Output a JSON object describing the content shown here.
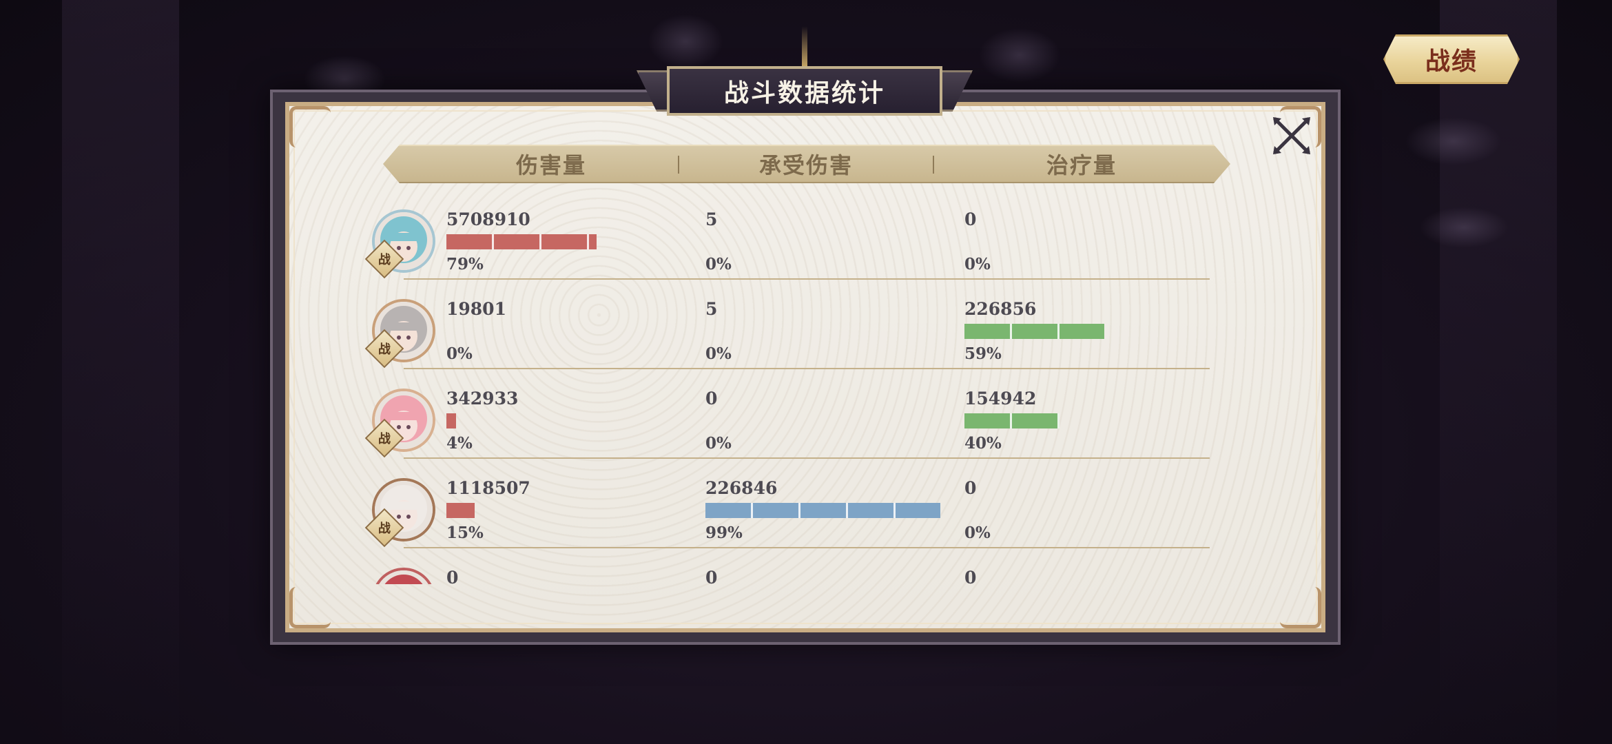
{
  "title": "战斗数据统计",
  "record_button": "战绩",
  "columns": [
    "伤害量",
    "承受伤害",
    "治疗量"
  ],
  "badge_label": "战",
  "colors": {
    "damage": "#c66762",
    "taken": "#7ea4c6",
    "heal": "#7ab66f"
  },
  "rows": [
    {
      "avatar": {
        "hair": "#7fc3cf",
        "skin": "#f4e2d8",
        "ring": "#a6c6d2"
      },
      "damage": {
        "value": "5708910",
        "pct": "79%",
        "frac": 0.79
      },
      "taken": {
        "value": "5",
        "pct": "0%",
        "frac": 0
      },
      "heal": {
        "value": "0",
        "pct": "0%",
        "frac": 0
      }
    },
    {
      "avatar": {
        "hair": "#b8b3b2",
        "skin": "#f4e2d8",
        "ring": "#c9a07a"
      },
      "damage": {
        "value": "19801",
        "pct": "0%",
        "frac": 0
      },
      "taken": {
        "value": "5",
        "pct": "0%",
        "frac": 0
      },
      "heal": {
        "value": "226856",
        "pct": "59%",
        "frac": 0.59
      }
    },
    {
      "avatar": {
        "hair": "#f0a4b0",
        "skin": "#f6e0dc",
        "ring": "#d8b090"
      },
      "damage": {
        "value": "342933",
        "pct": "4%",
        "frac": 0.04
      },
      "taken": {
        "value": "0",
        "pct": "0%",
        "frac": 0
      },
      "heal": {
        "value": "154942",
        "pct": "40%",
        "frac": 0.4
      }
    },
    {
      "avatar": {
        "hair": "#efeae6",
        "skin": "#f4e6e0",
        "ring": "#a47858"
      },
      "damage": {
        "value": "1118507",
        "pct": "15%",
        "frac": 0.15
      },
      "taken": {
        "value": "226846",
        "pct": "99%",
        "frac": 0.99
      },
      "heal": {
        "value": "0",
        "pct": "0%",
        "frac": 0
      }
    },
    {
      "avatar": {
        "hair": "#c24a52",
        "skin": "#f4e2d8",
        "ring": "#c06060"
      },
      "damage": {
        "value": "0",
        "pct": "",
        "frac": 0
      },
      "taken": {
        "value": "0",
        "pct": "",
        "frac": 0
      },
      "heal": {
        "value": "0",
        "pct": "",
        "frac": 0
      }
    }
  ]
}
